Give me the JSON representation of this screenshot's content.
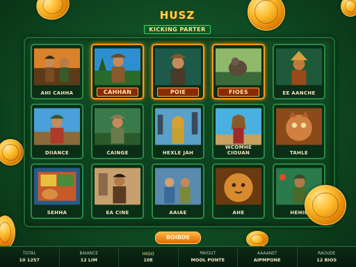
{
  "logo": {
    "title": "HUSZ",
    "subtitle": "KICKING PARTER"
  },
  "tiles": [
    {
      "label": "AHI CAHHA",
      "featured": false
    },
    {
      "label": "CAHHAN",
      "featured": true
    },
    {
      "label": "POIE",
      "featured": true
    },
    {
      "label": "FIOES",
      "featured": true
    },
    {
      "label": "EE AANCHE",
      "featured": false
    },
    {
      "label": "DIIANCE",
      "featured": false
    },
    {
      "label": "CAINGE",
      "featured": false
    },
    {
      "label": "HEXLE JAH",
      "featured": false
    },
    {
      "label": "WCOMHE CIOUAN",
      "featured": false
    },
    {
      "label": "TAHLE",
      "featured": false
    },
    {
      "label": "SEHHA",
      "featured": false
    },
    {
      "label": "EA CINE",
      "featured": false
    },
    {
      "label": "AAIAE",
      "featured": false
    },
    {
      "label": "AHE",
      "featured": false
    },
    {
      "label": "HEHIE",
      "featured": false
    }
  ],
  "play_button": {
    "label": "BOIBDE"
  },
  "footer": [
    {
      "label": "TOTAL",
      "value": "10 1257"
    },
    {
      "label": "BAIANCE",
      "value": "12 LIM"
    },
    {
      "label": "HIGO",
      "value": "10E"
    },
    {
      "label": "PAYOUT",
      "value": "MOOL PONTE"
    },
    {
      "label": "AAAANET",
      "value": "AIPMPONE"
    },
    {
      "label": "RAOUDE",
      "value": "12 BIOS"
    }
  ]
}
